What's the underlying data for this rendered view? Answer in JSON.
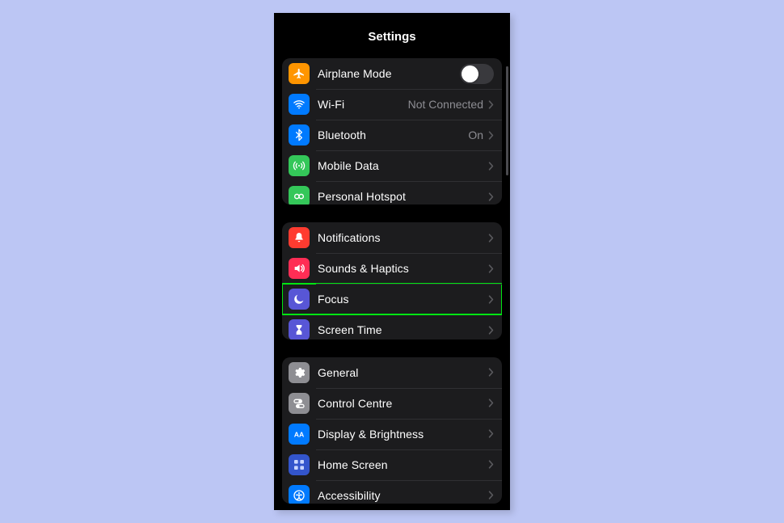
{
  "header": {
    "title": "Settings"
  },
  "groups": [
    {
      "rows": [
        {
          "id": "airplane-mode",
          "icon": "airplane",
          "iconBg": "#ff9500",
          "label": "Airplane Mode",
          "control": "toggle",
          "toggleOn": false
        },
        {
          "id": "wifi",
          "icon": "wifi",
          "iconBg": "#007aff",
          "label": "Wi-Fi",
          "control": "chevron",
          "value": "Not Connected"
        },
        {
          "id": "bluetooth",
          "icon": "bluetooth",
          "iconBg": "#007aff",
          "label": "Bluetooth",
          "control": "chevron",
          "value": "On"
        },
        {
          "id": "mobile-data",
          "icon": "antenna",
          "iconBg": "#34c759",
          "label": "Mobile Data",
          "control": "chevron"
        },
        {
          "id": "personal-hotspot",
          "icon": "hotspot",
          "iconBg": "#34c759",
          "label": "Personal Hotspot",
          "control": "chevron"
        }
      ]
    },
    {
      "rows": [
        {
          "id": "notifications",
          "icon": "bell",
          "iconBg": "#ff3b30",
          "label": "Notifications",
          "control": "chevron"
        },
        {
          "id": "sounds-haptics",
          "icon": "speaker",
          "iconBg": "#ff2d55",
          "label": "Sounds & Haptics",
          "control": "chevron"
        },
        {
          "id": "focus",
          "icon": "moon",
          "iconBg": "#5856d6",
          "label": "Focus",
          "control": "chevron",
          "highlighted": true
        },
        {
          "id": "screen-time",
          "icon": "hourglass",
          "iconBg": "#5856d6",
          "label": "Screen Time",
          "control": "chevron"
        }
      ]
    },
    {
      "rows": [
        {
          "id": "general",
          "icon": "gear",
          "iconBg": "#8e8e93",
          "label": "General",
          "control": "chevron"
        },
        {
          "id": "control-centre",
          "icon": "switches",
          "iconBg": "#8e8e93",
          "label": "Control Centre",
          "control": "chevron"
        },
        {
          "id": "display-brightness",
          "icon": "aa",
          "iconBg": "#007aff",
          "label": "Display & Brightness",
          "control": "chevron"
        },
        {
          "id": "home-screen",
          "icon": "grid",
          "iconBg": "#3355cc",
          "label": "Home Screen",
          "control": "chevron"
        },
        {
          "id": "accessibility",
          "icon": "access",
          "iconBg": "#007aff",
          "label": "Accessibility",
          "control": "chevron"
        }
      ]
    }
  ]
}
